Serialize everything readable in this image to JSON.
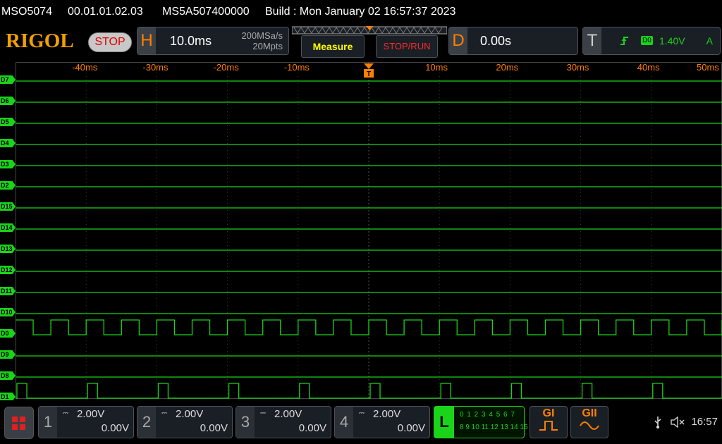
{
  "info": {
    "model": "MSO5074",
    "firmware": "00.01.01.02.03",
    "serial": "MS5A507400000",
    "build": "Build : Mon January 02 16:57:37 2023"
  },
  "header": {
    "logo": "RIGOL",
    "run_state": "STOP",
    "horizontal": {
      "letter": "H",
      "scale": "10.0ms",
      "sample_rate": "200MSa/s",
      "memory_depth": "20Mpts"
    },
    "measure_label": "Measure",
    "stop_run_label": "STOP/RUN",
    "delay": {
      "letter": "D",
      "value": "0.00s"
    },
    "trigger": {
      "letter": "T",
      "source": "D0",
      "level": "1.40V",
      "mode": "A"
    }
  },
  "grid": {
    "time_labels": [
      "-40ms",
      "-30ms",
      "-20ms",
      "-10ms",
      "10ms",
      "20ms",
      "30ms",
      "40ms",
      "50ms"
    ]
  },
  "channels": [
    {
      "label": "D7",
      "signal": "low"
    },
    {
      "label": "D6",
      "signal": "low"
    },
    {
      "label": "D5",
      "signal": "low"
    },
    {
      "label": "D4",
      "signal": "low"
    },
    {
      "label": "D3",
      "signal": "low"
    },
    {
      "label": "D2",
      "signal": "low"
    },
    {
      "label": "D15",
      "signal": "low"
    },
    {
      "label": "D14",
      "signal": "low"
    },
    {
      "label": "D13",
      "signal": "low"
    },
    {
      "label": "D12",
      "signal": "low"
    },
    {
      "label": "D11",
      "signal": "low"
    },
    {
      "label": "D10",
      "signal": "low"
    },
    {
      "label": "D0",
      "signal": "clock"
    },
    {
      "label": "D9",
      "signal": "low"
    },
    {
      "label": "D8",
      "signal": "low"
    },
    {
      "label": "D1",
      "signal": "pulse"
    }
  ],
  "analog_channels": [
    {
      "num": "1",
      "scale": "2.00V",
      "offset": "0.00V"
    },
    {
      "num": "2",
      "scale": "2.00V",
      "offset": "0.00V"
    },
    {
      "num": "3",
      "scale": "2.00V",
      "offset": "0.00V"
    },
    {
      "num": "4",
      "scale": "2.00V",
      "offset": "0.00V"
    }
  ],
  "la": {
    "letter": "L",
    "row1": "0 1 2 3  4 5 6 7",
    "row2": "8 9 10 11 12 13 14 15"
  },
  "generators": [
    {
      "label": "GI",
      "waveform": "square"
    },
    {
      "label": "GII",
      "waveform": "sine"
    }
  ],
  "status": {
    "time": "16:57"
  },
  "colors": {
    "digital": "#19d419",
    "accent": "#ff7f00",
    "grid": "#3a3a3a"
  }
}
